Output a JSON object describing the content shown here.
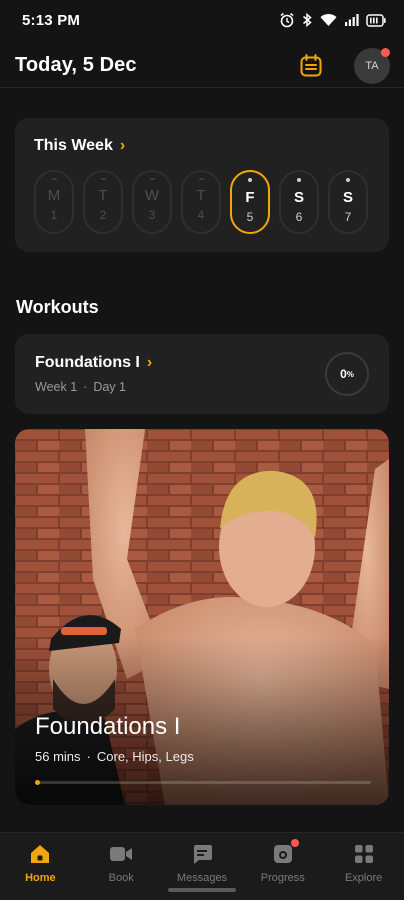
{
  "status": {
    "time": "5:13 PM"
  },
  "header": {
    "title": "Today, 5 Dec",
    "avatar_initials": "TA"
  },
  "week": {
    "title": "This Week",
    "days": [
      {
        "letter": "M",
        "num": "1",
        "state": "past"
      },
      {
        "letter": "T",
        "num": "2",
        "state": "past"
      },
      {
        "letter": "W",
        "num": "3",
        "state": "past"
      },
      {
        "letter": "T",
        "num": "4",
        "state": "past"
      },
      {
        "letter": "F",
        "num": "5",
        "state": "today"
      },
      {
        "letter": "S",
        "num": "6",
        "state": "upcoming"
      },
      {
        "letter": "S",
        "num": "7",
        "state": "upcoming"
      }
    ]
  },
  "workouts": {
    "section_title": "Workouts",
    "program": {
      "title": "Foundations I",
      "week": "Week 1",
      "separator": "·",
      "day": "Day 1",
      "progress": "0",
      "progress_unit": "%"
    },
    "feature": {
      "title": "Foundations I",
      "duration": "56 mins",
      "separator": "·",
      "focus": "Core, Hips, Legs",
      "progress_fraction": 0.0
    }
  },
  "tabs": [
    {
      "label": "Home",
      "icon": "home-icon",
      "active": true
    },
    {
      "label": "Book",
      "icon": "video-icon",
      "active": false
    },
    {
      "label": "Messages",
      "icon": "chat-icon",
      "active": false
    },
    {
      "label": "Progress",
      "icon": "camera-icon",
      "active": false
    },
    {
      "label": "Explore",
      "icon": "grid-icon",
      "active": false
    }
  ],
  "colors": {
    "accent": "#f2a60c",
    "background": "#141414",
    "card": "#212121",
    "notification": "#ff5a4e"
  }
}
